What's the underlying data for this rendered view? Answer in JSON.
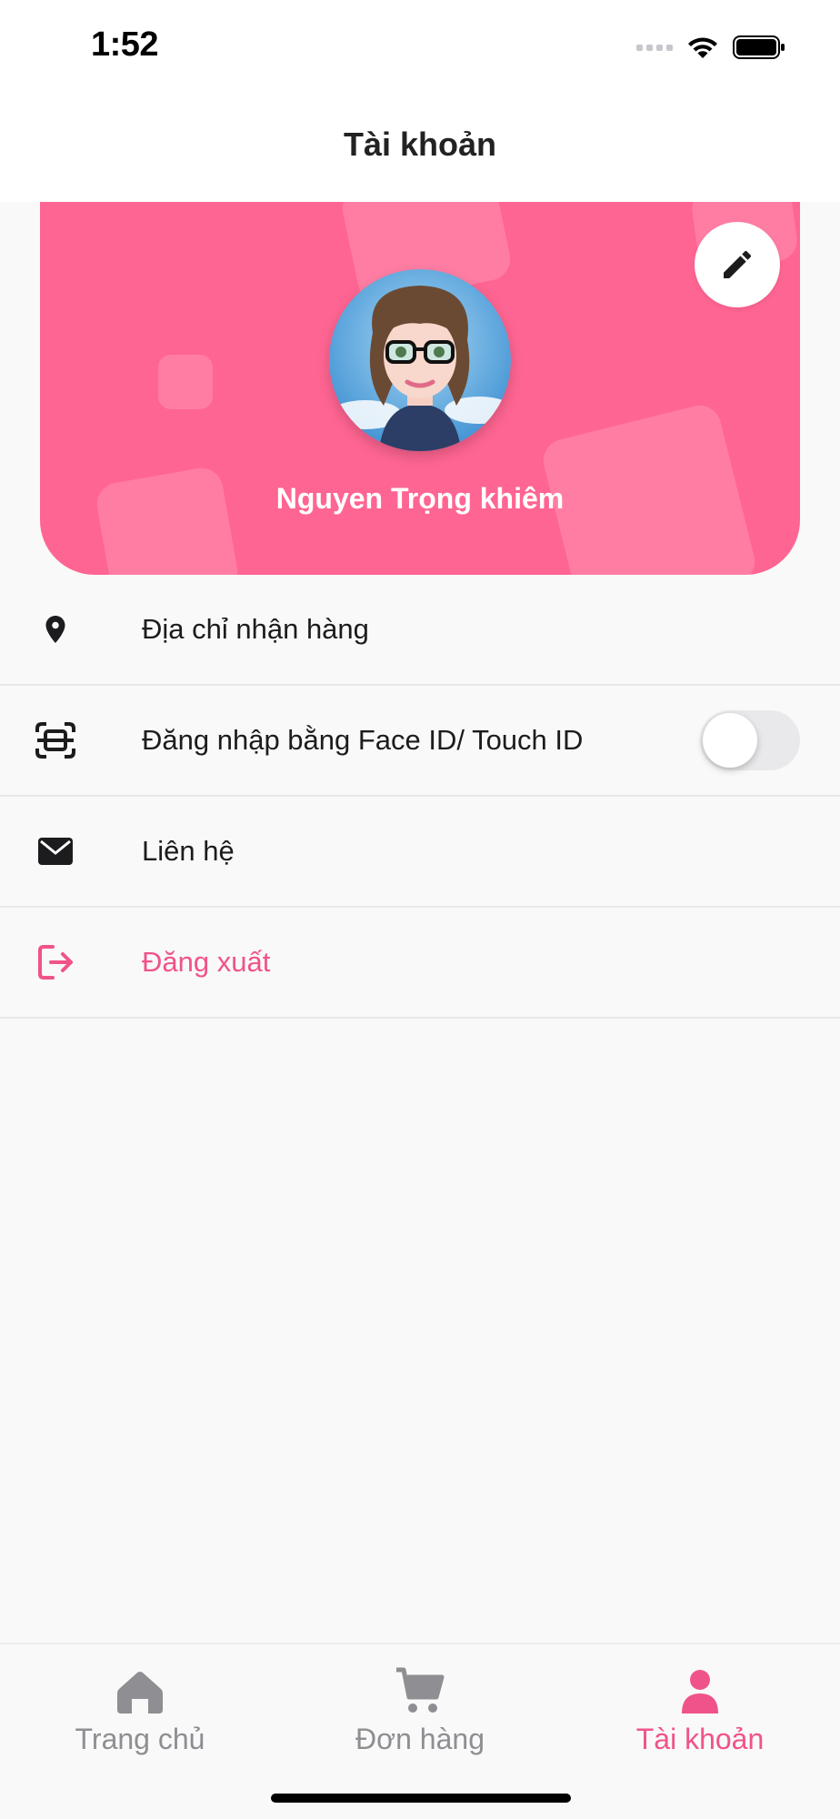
{
  "status_bar": {
    "time": "1:52"
  },
  "header": {
    "title": "Tài khoản"
  },
  "profile": {
    "name": "Nguyen Trọng khiêm",
    "edit_icon": "pencil-icon",
    "card_color": "#ff6592"
  },
  "menu": {
    "items": [
      {
        "label": "Địa chỉ nhận hàng",
        "icon": "location-pin-icon"
      },
      {
        "label": "Đăng nhập bằng Face ID/ Touch ID",
        "icon": "face-scan-icon",
        "toggle_on": false
      },
      {
        "label": "Liên hệ",
        "icon": "mail-icon"
      },
      {
        "label": "Đăng xuất",
        "icon": "logout-icon",
        "color": "#f0538a"
      }
    ]
  },
  "tabbar": {
    "tabs": [
      {
        "label": "Trang chủ",
        "icon": "home-icon",
        "active": false
      },
      {
        "label": "Đơn hàng",
        "icon": "cart-icon",
        "active": false
      },
      {
        "label": "Tài khoản",
        "icon": "person-icon",
        "active": true
      }
    ],
    "active_color": "#f0538a",
    "inactive_color": "#8e8e93"
  }
}
